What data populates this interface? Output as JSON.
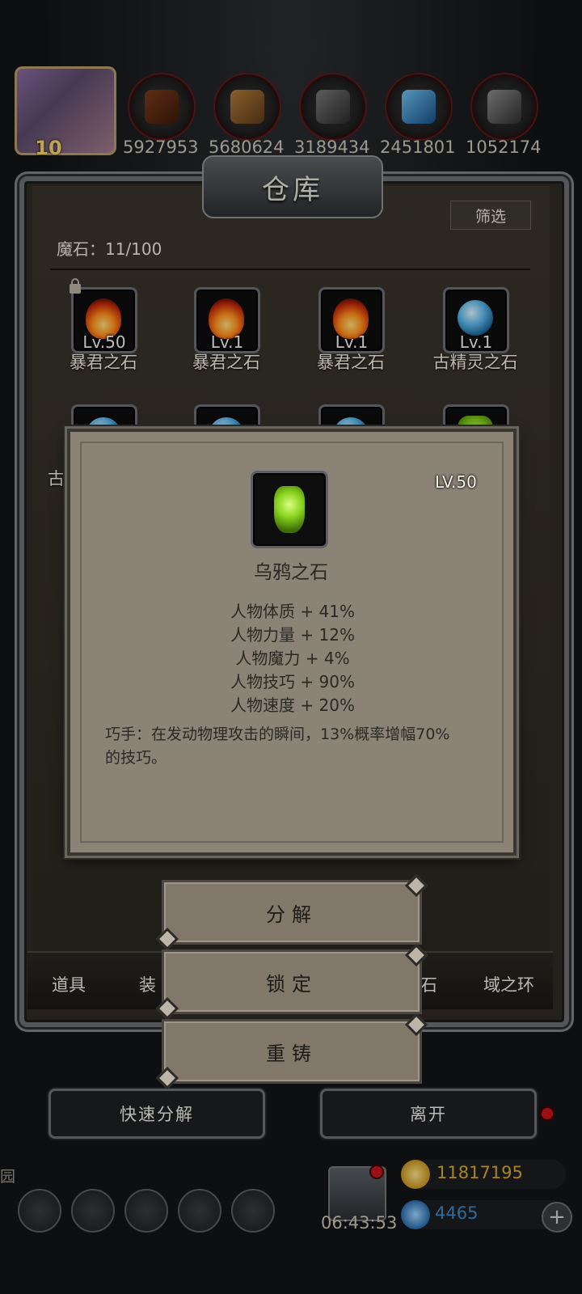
{
  "resources": {
    "avatar_level": "10",
    "values": [
      "5927953",
      "5680624",
      "3189434",
      "2451801",
      "1052174"
    ]
  },
  "warehouse": {
    "title": "仓库",
    "filter_label": "筛选",
    "count_label": "魔石：11/100",
    "slots": [
      {
        "level": "Lv.50",
        "name": "暴君之石",
        "gem": "fire-gem-icon",
        "locked": true
      },
      {
        "level": "Lv.1",
        "name": "暴君之石",
        "gem": "fire-gem-icon"
      },
      {
        "level": "Lv.1",
        "name": "暴君之石",
        "gem": "fire-gem-icon"
      },
      {
        "level": "Lv.1",
        "name": "古精灵之石",
        "gem": "ice-gem-icon"
      },
      {
        "gem": "ice-gem-icon",
        "name_fragment": "古"
      },
      {
        "gem": "ice-gem-icon"
      },
      {
        "gem": "ice-gem-icon"
      },
      {
        "gem": "crow-gem-icon"
      }
    ],
    "tabs": [
      "道具",
      "装",
      "石",
      "域之环"
    ]
  },
  "detail": {
    "level": "LV.50",
    "name": "乌鸦之石",
    "stats": [
      "人物体质 + 41%",
      "人物力量 + 12%",
      "人物魔力 + 4%",
      "人物技巧 + 90%",
      "人物速度 + 20%"
    ],
    "skill": "巧手：在发动物理攻击的瞬间，13%概率增幅70%的技巧。"
  },
  "menu": {
    "decompose": "分解",
    "lock": "锁定",
    "reforge": "重铸"
  },
  "actions": {
    "quick_decompose": "快速分解",
    "leave": "离开"
  },
  "hud": {
    "timer": "06:43:53",
    "gold": "11817195",
    "gems": "4465",
    "side_char": "园"
  },
  "colors": {
    "gold": "#d9a930",
    "gem_blue": "#3b88c7",
    "alert_red": "#c4161c"
  }
}
